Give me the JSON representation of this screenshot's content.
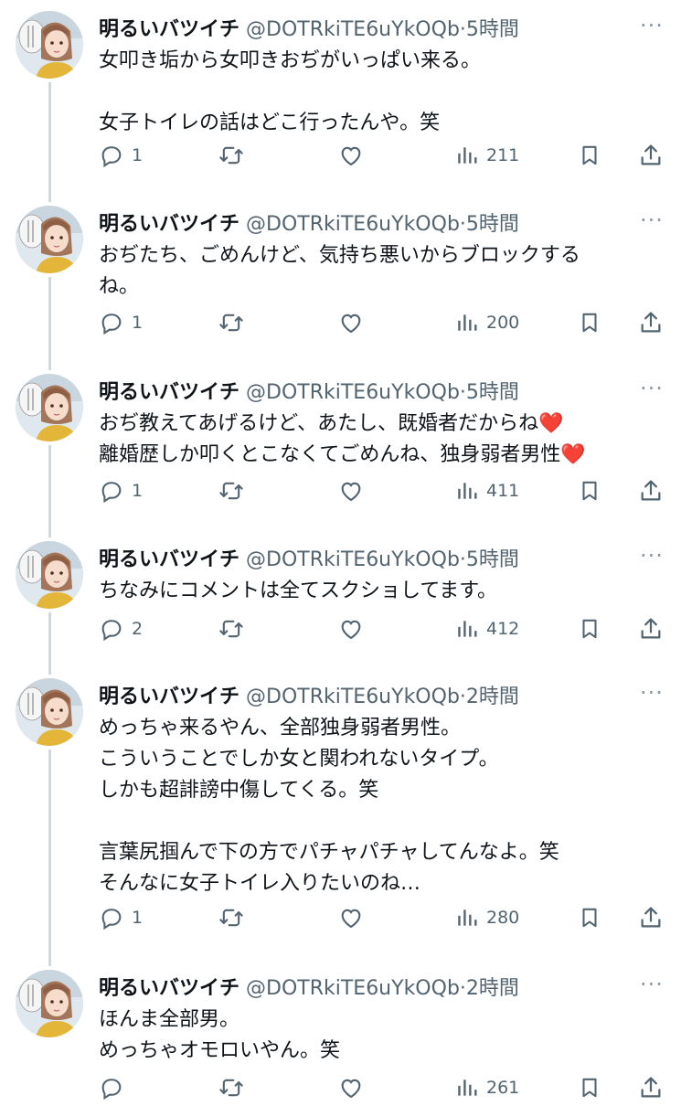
{
  "author": {
    "name": "明るいバツイチ",
    "handle": "@DOTRkiTE6uYkOQb",
    "separator": "·"
  },
  "tweets": [
    {
      "time": "5時間",
      "lines": [
        "女叩き垢から女叩きおぢがいっぱい来る。",
        "",
        "女子トイレの話はどこ行ったんや。笑"
      ],
      "replies": "1",
      "views": "211"
    },
    {
      "time": "5時間",
      "lines": [
        "おぢたち、ごめんけど、気持ち悪いからブロックする",
        "ね。"
      ],
      "replies": "1",
      "views": "200"
    },
    {
      "time": "5時間",
      "lines": [
        "おぢ教えてあげるけど、あたし、既婚者だからね❤️",
        "離婚歴しか叩くとこなくてごめんね、独身弱者男性❤️"
      ],
      "replies": "1",
      "views": "411"
    },
    {
      "time": "5時間",
      "lines": [
        "ちなみにコメントは全てスクショしてます。"
      ],
      "replies": "2",
      "views": "412"
    },
    {
      "time": "2時間",
      "lines": [
        "めっちゃ来るやん、全部独身弱者男性。",
        "こういうことでしか女と関われないタイプ。",
        "しかも超誹謗中傷してくる。笑",
        "",
        "言葉尻掴んで下の方でパチャパチャしてんなよ。笑",
        "そんなに女子トイレ入りたいのね…"
      ],
      "replies": "1",
      "views": "280"
    },
    {
      "time": "2時間",
      "lines": [
        "ほんま全部男。",
        "めっちゃオモロいやん。笑"
      ],
      "replies": "",
      "views": "261"
    }
  ],
  "icons": {
    "reply": "reply-icon",
    "retweet": "retweet-icon",
    "like": "like-icon",
    "views": "views-icon",
    "bookmark": "bookmark-icon",
    "share": "share-icon",
    "more": "more-icon"
  },
  "colors": {
    "text": "#0f1419",
    "secondary": "#536471",
    "thread_line": "#cfd9de",
    "emoji_heart": "#e0245e"
  }
}
